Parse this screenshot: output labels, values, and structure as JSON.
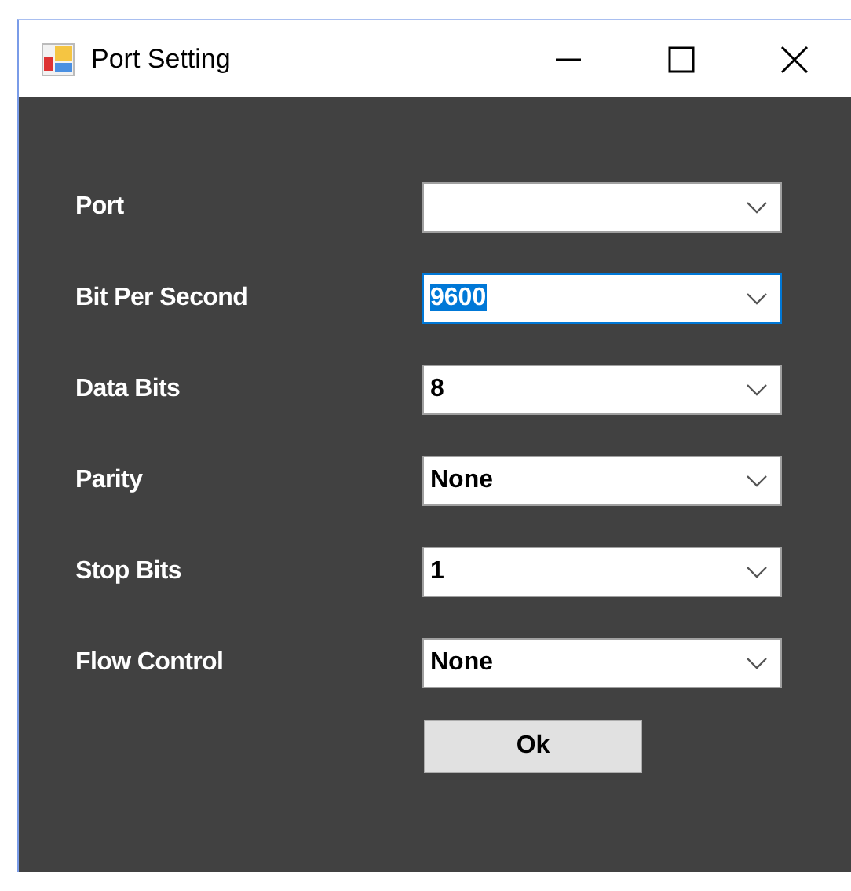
{
  "window": {
    "title": "Port Setting"
  },
  "fields": [
    {
      "label": "Port",
      "focused": false
    },
    {
      "label": "Bit Per Second",
      "value": "9600",
      "focused": true
    },
    {
      "label": "Data Bits",
      "value": "8",
      "focused": false
    },
    {
      "label": "Parity",
      "value": "None",
      "focused": false
    },
    {
      "label": "Stop Bits",
      "value": "1",
      "focused": false
    },
    {
      "label": "Flow Control",
      "value": "None",
      "focused": false
    }
  ],
  "button": "Ok"
}
